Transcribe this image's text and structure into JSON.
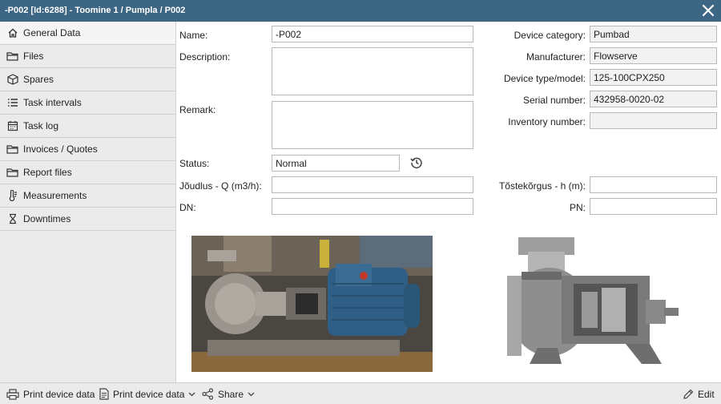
{
  "window": {
    "title": "-P002 [Id:6288] - Toomine 1 / Pumpla / P002"
  },
  "sidebar": {
    "items": [
      {
        "label": "General Data",
        "icon": "home-icon"
      },
      {
        "label": "Files",
        "icon": "folder-icon"
      },
      {
        "label": "Spares",
        "icon": "box-icon"
      },
      {
        "label": "Task intervals",
        "icon": "list-icon"
      },
      {
        "label": "Task log",
        "icon": "calendar-icon"
      },
      {
        "label": "Invoices / Quotes",
        "icon": "folder-icon"
      },
      {
        "label": "Report files",
        "icon": "folder-icon"
      },
      {
        "label": "Measurements",
        "icon": "thermometer-icon"
      },
      {
        "label": "Downtimes",
        "icon": "hourglass-icon"
      }
    ]
  },
  "form": {
    "name": {
      "label": "Name:",
      "value": "-P002"
    },
    "description": {
      "label": "Description:",
      "value": ""
    },
    "remark": {
      "label": "Remark:",
      "value": ""
    },
    "status": {
      "label": "Status:",
      "value": "Normal"
    },
    "capacity": {
      "label": "Jõudlus - Q (m3/h):",
      "value": ""
    },
    "dn": {
      "label": "DN:",
      "value": ""
    },
    "device_category": {
      "label": "Device category:",
      "value": "Pumbad"
    },
    "manufacturer": {
      "label": "Manufacturer:",
      "value": "Flowserve"
    },
    "device_type": {
      "label": "Device type/model:",
      "value": "125-100CPX250"
    },
    "serial_number": {
      "label": "Serial number:",
      "value": "432958-0020-02"
    },
    "inventory_number": {
      "label": "Inventory number:",
      "value": ""
    },
    "lift_height": {
      "label": "Tõstekõrgus - h (m):",
      "value": ""
    },
    "pn": {
      "label": "PN:",
      "value": ""
    }
  },
  "footer": {
    "print1": "Print device data",
    "print2": "Print device data",
    "share": "Share",
    "edit": "Edit"
  },
  "colors": {
    "titlebar": "#3d6584",
    "sidebar": "#ebebeb",
    "motor_blue": "#2f5f86"
  }
}
